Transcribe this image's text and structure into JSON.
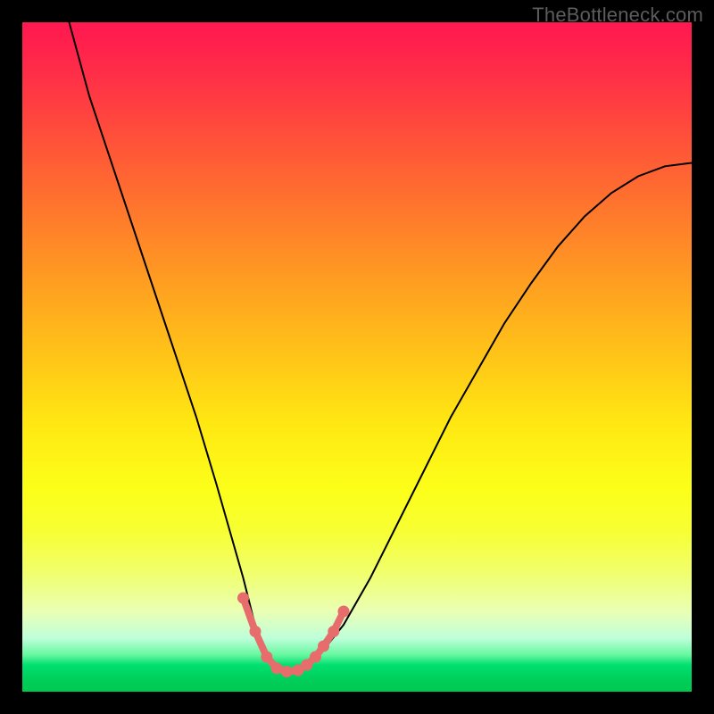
{
  "watermark": "TheBottleneck.com",
  "chart_data": {
    "type": "line",
    "title": "",
    "xlabel": "",
    "ylabel": "",
    "xlim": [
      0,
      100
    ],
    "ylim": [
      0,
      100
    ],
    "grid": false,
    "series": [
      {
        "name": "bottleneck-curve",
        "x": [
          7,
          10,
          14,
          18,
          22,
          26,
          29,
          31,
          33,
          34.5,
          36,
          37.5,
          39,
          41,
          44,
          48,
          52,
          56,
          60,
          64,
          68,
          72,
          76,
          80,
          84,
          88,
          92,
          96,
          100
        ],
        "y": [
          100,
          89,
          77,
          65,
          53,
          41,
          31,
          24,
          17,
          11,
          6,
          3.5,
          3,
          3.3,
          5,
          10,
          17,
          25,
          33,
          41,
          48,
          55,
          61,
          66.5,
          71,
          74.5,
          77,
          78.5,
          79
        ]
      }
    ],
    "markers": {
      "name": "optimal-range-markers",
      "x": [
        33,
        34.8,
        36.5,
        38,
        39.5,
        41.2,
        42.5,
        43.8,
        45,
        46.5,
        48
      ],
      "y": [
        14,
        9,
        5.2,
        3.5,
        3.0,
        3.2,
        4.0,
        5.2,
        6.8,
        9.0,
        12
      ]
    },
    "optimal_x": 39,
    "description": "V-shaped bottleneck curve on heatmap gradient (red=high bottleneck, green=optimal). Minimum around x≈39. Pink markers highlight the near-optimal region at the bottom of the valley."
  }
}
